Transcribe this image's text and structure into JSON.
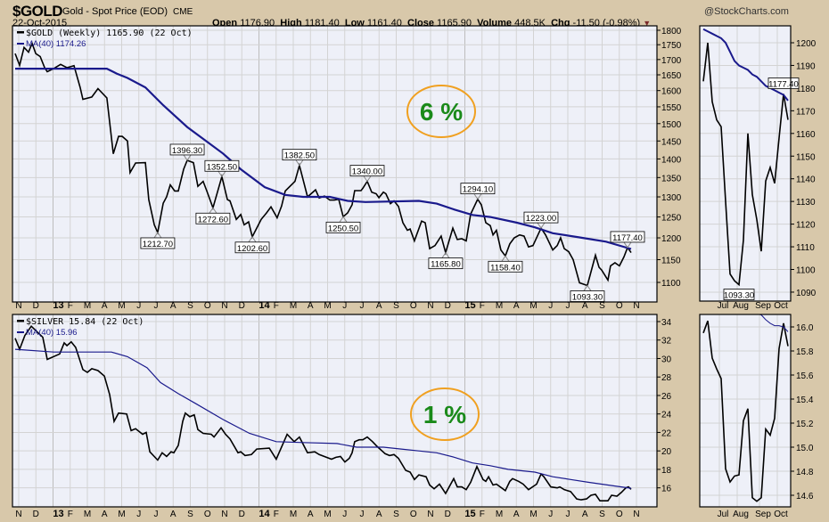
{
  "header": {
    "symbol": "$GOLD",
    "description": "Gold - Spot Price (EOD)",
    "exchange": "CME",
    "date": "22-Oct-2015",
    "open_label": "Open",
    "open": "1176.90",
    "high_label": "High",
    "high": "1181.40",
    "low_label": "Low",
    "low": "1161.40",
    "close_label": "Close",
    "close": "1165.90",
    "volume_label": "Volume",
    "volume": "448.5K",
    "chg_label": "Chg",
    "chg": "-11.50 (-0.98%)",
    "chg_arrow": "▼",
    "copyright": "@StockCharts.com"
  },
  "colors": {
    "price": "#000000",
    "ma": "#1a1a8c",
    "panel_bg": "#eef0f8",
    "grid": "#d3d3d3",
    "oval": "#f0a020",
    "pct_text": "#1a8a1a",
    "page_bg": "#d8c8aa"
  },
  "chart_data": [
    {
      "type": "line",
      "title": "$GOLD (Weekly) 1165.90 (22 Oct)",
      "x_unit": "months since 1-Nov-2012",
      "xlim": [
        -0.25,
        36.5
      ],
      "yscale": "log",
      "ylim": [
        1060,
        1815
      ],
      "yticks": [
        1100,
        1150,
        1200,
        1250,
        1300,
        1350,
        1400,
        1450,
        1500,
        1550,
        1600,
        1650,
        1700,
        1750,
        1800
      ],
      "xtick_labels": [
        "N",
        "D",
        "13",
        "F",
        "M",
        "A",
        "M",
        "J",
        "J",
        "A",
        "S",
        "O",
        "N",
        "D",
        "14",
        "F",
        "M",
        "A",
        "M",
        "J",
        "J",
        "A",
        "S",
        "O",
        "N",
        "D",
        "15",
        "F",
        "M",
        "A",
        "M",
        "J",
        "J",
        "A",
        "S",
        "O",
        "N"
      ],
      "legend": [
        "$GOLD (Weekly) 1165.90 (22 Oct)",
        "MA(40) 1174.26"
      ],
      "annotation_big": "6 %",
      "series": [
        {
          "name": "$GOLD",
          "t": [
            -0.21,
            0.05,
            0.31,
            0.57,
            0.78,
            0.99,
            1.25,
            1.51,
            1.66,
            2.03,
            2.44,
            2.81,
            3.22,
            3.58,
            3.74,
            4.26,
            4.62,
            5.14,
            5.51,
            5.82,
            6.03,
            6.34,
            6.49,
            6.81,
            7.38,
            7.58,
            7.9,
            8.1,
            8.42,
            8.62,
            8.83,
            9.09,
            9.3,
            9.61,
            9.82,
            10.18,
            10.44,
            10.75,
            10.96,
            11.32,
            11.84,
            12.16,
            12.31,
            12.68,
            12.94,
            13.14,
            13.4,
            13.61,
            13.97,
            14.13,
            14.44,
            14.7,
            15.06,
            15.32,
            15.53,
            16.1,
            16.36,
            16.83,
            17.3,
            17.51,
            17.82,
            18.13,
            18.39,
            18.65,
            18.91,
            19.17,
            19.43,
            19.58,
            19.95,
            20.05,
            20.31,
            20.57,
            20.83,
            20.99,
            21.25,
            21.4,
            21.66,
            21.87,
            22.13,
            22.39,
            22.65,
            22.81,
            23.06,
            23.48,
            23.69,
            23.95,
            24.26,
            24.62,
            24.88,
            25.3,
            25.56,
            25.82,
            26.08,
            26.34,
            26.75,
            26.96,
            27.22,
            27.48,
            27.64,
            27.84,
            28.1,
            28.36,
            28.62,
            28.88,
            29.19,
            29.45,
            29.71,
            29.97,
            30.44,
            30.7,
            31.12,
            31.38,
            31.58,
            31.79,
            32.05,
            32.31,
            32.68,
            33.14,
            33.61,
            33.82,
            33.97,
            34.34,
            34.49,
            34.75,
            35.01,
            35.27,
            35.48,
            35.69
          ],
          "values": [
            1720,
            1681,
            1741,
            1725,
            1755,
            1720,
            1710,
            1673,
            1660,
            1670,
            1684,
            1673,
            1680,
            1610,
            1573,
            1580,
            1606,
            1577,
            1414,
            1463,
            1463,
            1450,
            1363,
            1389,
            1390,
            1293,
            1231,
            1212.7,
            1284,
            1300,
            1331,
            1315,
            1315,
            1372,
            1396.3,
            1390,
            1327,
            1340,
            1315,
            1272.6,
            1352.5,
            1293,
            1290,
            1244,
            1256,
            1231,
            1238,
            1202.6,
            1231,
            1244,
            1260,
            1275,
            1248,
            1277,
            1315,
            1340,
            1382.5,
            1300,
            1318,
            1297,
            1302,
            1292,
            1292,
            1294,
            1250.5,
            1260,
            1280,
            1316,
            1316,
            1322,
            1340,
            1312,
            1308,
            1298,
            1312,
            1308,
            1283,
            1290,
            1276,
            1236,
            1218,
            1221,
            1193,
            1240,
            1236,
            1175,
            1182,
            1204,
            1165.8,
            1223,
            1196,
            1198,
            1193,
            1257,
            1294.1,
            1280,
            1236,
            1229,
            1207,
            1218,
            1172,
            1158.4,
            1186,
            1200,
            1207,
            1204,
            1179,
            1182,
            1223,
            1207,
            1172,
            1182,
            1200,
            1175,
            1168,
            1150,
            1099,
            1093.3,
            1160,
            1133,
            1127,
            1105,
            1136,
            1143,
            1136,
            1156,
            1177.4,
            1165.9
          ]
        },
        {
          "name": "MA(40)",
          "t": [
            -0.21,
            5.14,
            5.71,
            6.34,
            7.38,
            8.42,
            9.82,
            10.86,
            11.9,
            12.94,
            14.34,
            15.53,
            16.57,
            18.13,
            19.17,
            20.21,
            23.32,
            24.36,
            25.4,
            26.44,
            27.48,
            29.04,
            30.08,
            31.12,
            32.68,
            34.23,
            35.69
          ],
          "values": [
            1670,
            1670,
            1654,
            1640,
            1610,
            1555,
            1490,
            1452,
            1415,
            1372,
            1325,
            1305,
            1300,
            1300,
            1290,
            1287,
            1290,
            1283,
            1268,
            1255,
            1250,
            1236,
            1225,
            1211,
            1201,
            1191,
            1174.26
          ]
        }
      ],
      "annotations": [
        {
          "t": 8.1,
          "value": 1212.7,
          "label": "1212.70",
          "pos": "below"
        },
        {
          "t": 9.82,
          "value": 1396.3,
          "label": "1396.30",
          "pos": "above"
        },
        {
          "t": 11.32,
          "value": 1272.6,
          "label": "1272.60",
          "pos": "below"
        },
        {
          "t": 11.84,
          "value": 1352.5,
          "label": "1352.50",
          "pos": "above"
        },
        {
          "t": 13.61,
          "value": 1202.6,
          "label": "1202.60",
          "pos": "below"
        },
        {
          "t": 16.36,
          "value": 1382.5,
          "label": "1382.50",
          "pos": "above"
        },
        {
          "t": 18.91,
          "value": 1250.5,
          "label": "1250.50",
          "pos": "below"
        },
        {
          "t": 20.31,
          "value": 1340.0,
          "label": "1340.00",
          "pos": "above"
        },
        {
          "t": 24.88,
          "value": 1165.8,
          "label": "1165.80",
          "pos": "below"
        },
        {
          "t": 26.75,
          "value": 1294.1,
          "label": "1294.10",
          "pos": "above"
        },
        {
          "t": 28.36,
          "value": 1158.4,
          "label": "1158.40",
          "pos": "below"
        },
        {
          "t": 30.44,
          "value": 1223.0,
          "label": "1223.00",
          "pos": "above"
        },
        {
          "t": 33.14,
          "value": 1093.3,
          "label": "1093.30",
          "pos": "below"
        },
        {
          "t": 35.48,
          "value": 1177.4,
          "label": "1177.40",
          "pos": "above"
        }
      ]
    },
    {
      "type": "line",
      "title": "$SILVER 15.84 (22 Oct)",
      "x_unit": "months since 1-Nov-2012",
      "xlim": [
        -0.25,
        36.5
      ],
      "yscale": "linear",
      "ylim": [
        13.25,
        34.75
      ],
      "yticks": [
        16,
        18,
        20,
        22,
        24,
        26,
        28,
        30,
        32,
        34
      ],
      "legend": [
        "$SILVER 15.84 (22 Oct)",
        "MA(40) 15.96"
      ],
      "annotation_big": "1 %",
      "series": [
        {
          "name": "$SILVER",
          "t": [
            -0.21,
            0.05,
            0.36,
            0.73,
            1.4,
            1.66,
            2.39,
            2.65,
            2.81,
            3.06,
            3.32,
            3.74,
            4.0,
            4.26,
            4.62,
            4.99,
            5.3,
            5.56,
            5.82,
            6.29,
            6.55,
            6.81,
            7.22,
            7.43,
            7.64,
            8.1,
            8.36,
            8.62,
            8.88,
            9.04,
            9.3,
            9.56,
            9.71,
            9.97,
            10.23,
            10.44,
            10.75,
            11.22,
            11.38,
            11.79,
            12.05,
            12.31,
            12.78,
            12.94,
            13.19,
            13.56,
            13.87,
            14.6,
            15.01,
            15.64,
            16.05,
            16.36,
            16.83,
            17.25,
            17.51,
            18.23,
            18.49,
            18.75,
            19.01,
            19.27,
            19.43,
            19.58,
            19.84,
            20.05,
            20.31,
            20.62,
            20.88,
            21.35,
            21.61,
            21.87,
            22.13,
            22.55,
            22.81,
            23.06,
            23.32,
            23.74,
            23.95,
            24.21,
            24.52,
            24.88,
            25.35,
            25.56,
            25.82,
            26.08,
            26.34,
            26.7,
            27.06,
            27.22,
            27.38,
            27.64,
            27.84,
            28.36,
            28.62,
            28.78,
            29.14,
            29.4,
            29.71,
            30.18,
            30.44,
            30.6,
            31.01,
            31.38,
            31.53,
            31.79,
            32.16,
            32.52,
            32.78,
            33.09,
            33.35,
            33.61,
            33.87,
            34.34,
            34.55,
            34.86,
            35.12,
            35.38,
            35.53,
            35.69
          ],
          "values": [
            32.2,
            31.0,
            32.5,
            33.5,
            32.3,
            29.9,
            30.5,
            31.7,
            31.4,
            31.8,
            31.2,
            28.8,
            28.5,
            28.9,
            28.7,
            28.1,
            26.1,
            23.2,
            24.1,
            24.0,
            22.2,
            22.4,
            21.8,
            22.0,
            19.9,
            19.0,
            19.8,
            19.4,
            19.9,
            19.8,
            20.6,
            23.2,
            24.1,
            23.7,
            23.9,
            22.3,
            21.9,
            21.8,
            21.5,
            22.5,
            21.8,
            21.3,
            19.8,
            19.9,
            19.5,
            19.6,
            20.2,
            20.3,
            19.1,
            21.8,
            21.0,
            21.5,
            19.8,
            19.9,
            19.6,
            19.1,
            19.3,
            19.4,
            18.8,
            19.2,
            19.8,
            21.0,
            21.2,
            21.2,
            21.5,
            21.0,
            20.5,
            19.7,
            19.5,
            19.6,
            19.2,
            17.9,
            17.7,
            16.9,
            17.4,
            17.2,
            16.3,
            15.9,
            16.4,
            15.4,
            17.0,
            16.1,
            16.1,
            15.8,
            16.6,
            18.3,
            16.9,
            16.7,
            17.2,
            16.3,
            16.4,
            15.7,
            16.7,
            17.0,
            16.7,
            16.4,
            15.8,
            16.4,
            17.5,
            17.2,
            16.1,
            16.0,
            16.1,
            15.8,
            15.6,
            14.8,
            14.7,
            14.8,
            15.2,
            15.3,
            14.6,
            14.6,
            15.2,
            15.1,
            15.5,
            16.0,
            16.1,
            15.84
          ]
        },
        {
          "name": "MA(40)",
          "t": [
            -0.21,
            2.03,
            5.4,
            6.34,
            7.48,
            8.26,
            9.3,
            10.34,
            11.9,
            13.45,
            15.01,
            16.57,
            18.55,
            19.69,
            21.25,
            22.29,
            23.32,
            24.36,
            25.4,
            26.44,
            27.48,
            28.52,
            30.08,
            31.12,
            32.16,
            33.19,
            34.75,
            35.69
          ],
          "values": [
            31.0,
            30.7,
            30.7,
            30.2,
            29.0,
            27.4,
            26.2,
            25.1,
            23.4,
            21.9,
            21.0,
            20.9,
            20.8,
            20.4,
            20.4,
            20.2,
            20.0,
            19.8,
            19.3,
            18.7,
            18.4,
            18.0,
            17.7,
            17.2,
            16.9,
            16.6,
            16.2,
            15.96
          ]
        }
      ]
    },
    {
      "type": "line",
      "title": "$GOLD daily zoom",
      "yscale": "linear",
      "ylim": [
        1085,
        1208
      ],
      "yticks": [
        1090,
        1100,
        1110,
        1120,
        1130,
        1140,
        1150,
        1160,
        1170,
        1180,
        1190,
        1200
      ],
      "month_labels": [
        "Jul",
        "Aug",
        "Sep",
        "Oct"
      ],
      "month_label_index": [
        4,
        8,
        13,
        17
      ],
      "series": [
        {
          "name": "$GOLD",
          "values": [
            1183,
            1200,
            1174,
            1166,
            1163,
            1130,
            1098,
            1095,
            1093.3,
            1113,
            1160,
            1133,
            1122,
            1108,
            1139,
            1145,
            1138,
            1158,
            1177.4,
            1166
          ]
        },
        {
          "name": "MA(40)",
          "values": [
            1206,
            1205,
            1204,
            1203,
            1202,
            1200,
            1196,
            1192,
            1190,
            1189,
            1188,
            1186,
            1185,
            1183,
            1181,
            1180,
            1179,
            1178,
            1177,
            1174.5
          ]
        }
      ],
      "annotations": [
        {
          "index": 8,
          "label": "1093.30",
          "pos": "below"
        },
        {
          "index": 18,
          "label": "1177.40",
          "pos": "above"
        }
      ]
    },
    {
      "type": "line",
      "title": "$SILVER daily zoom",
      "yscale": "linear",
      "ylim": [
        14.5,
        16.1
      ],
      "yticks": [
        14.6,
        14.8,
        15.0,
        15.2,
        15.4,
        15.6,
        15.8,
        16.0
      ],
      "month_labels": [
        "Jul",
        "Aug",
        "Sep",
        "Oct"
      ],
      "month_label_index": [
        4,
        8,
        13,
        17
      ],
      "series": [
        {
          "name": "$SILVER",
          "values": [
            15.95,
            16.05,
            15.74,
            15.65,
            15.57,
            14.82,
            14.71,
            14.76,
            14.77,
            15.22,
            15.32,
            14.58,
            14.55,
            14.58,
            15.15,
            15.1,
            15.24,
            15.82,
            16.03,
            15.84
          ]
        },
        {
          "name": "MA(40)",
          "values": [
            16.6,
            16.55,
            16.5,
            16.45,
            16.4,
            16.35,
            16.3,
            16.26,
            16.22,
            16.19,
            16.16,
            16.13,
            16.11,
            16.1,
            16.06,
            16.03,
            16.01,
            16.01,
            16.0,
            15.96
          ]
        }
      ]
    }
  ]
}
